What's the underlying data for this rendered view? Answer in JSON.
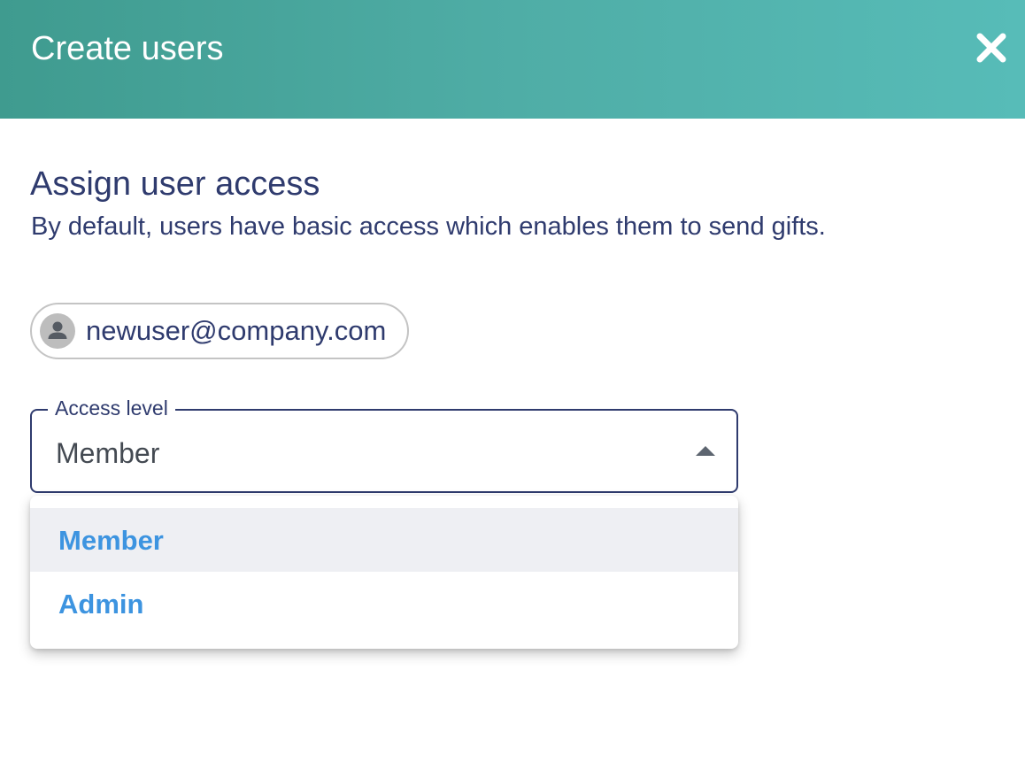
{
  "dialog": {
    "title": "Create users",
    "close_icon": "close-icon"
  },
  "section": {
    "title": "Assign user access",
    "description": "By default, users have basic access which enables them to send gifts."
  },
  "user_chip": {
    "avatar_icon": "person-icon",
    "email": "newuser@company.com"
  },
  "access_select": {
    "label": "Access level",
    "value": "Member",
    "arrow_icon": "caret-up-icon",
    "expanded": true
  },
  "dropdown": {
    "options": [
      {
        "label": "Member",
        "selected": true
      },
      {
        "label": "Admin",
        "selected": false
      }
    ]
  },
  "colors": {
    "header_gradient_start": "#3f9b8f",
    "header_gradient_end": "#57bcb8",
    "text_primary": "#2f3b6e",
    "option_text": "#3d94e0",
    "selected_option_bg": "#eeeff3"
  }
}
